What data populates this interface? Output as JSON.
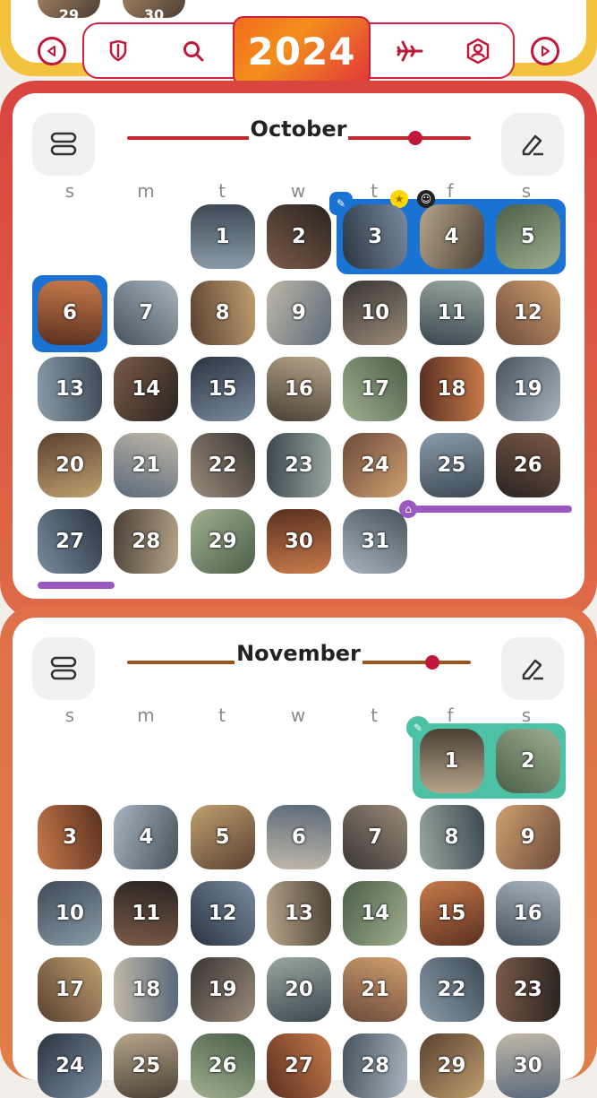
{
  "header": {
    "year": "2024",
    "peek_days": [
      "29",
      "30"
    ],
    "toolbar_icons": [
      "shield-icon",
      "search-icon",
      "airplane-icon",
      "profile-icon"
    ]
  },
  "months": [
    {
      "name": "October",
      "weekdays": [
        "s",
        "m",
        "t",
        "w",
        "t",
        "f",
        "s"
      ],
      "days": [
        "1",
        "2",
        "3",
        "4",
        "5",
        "6",
        "7",
        "8",
        "9",
        "10",
        "11",
        "12",
        "13",
        "14",
        "15",
        "16",
        "17",
        "18",
        "19",
        "20",
        "21",
        "22",
        "23",
        "24",
        "25",
        "26",
        "27",
        "28",
        "29",
        "30",
        "31"
      ]
    },
    {
      "name": "November",
      "weekdays": [
        "s",
        "m",
        "t",
        "w",
        "t",
        "f",
        "s"
      ],
      "days": [
        "1",
        "2",
        "3",
        "4",
        "5",
        "6",
        "7",
        "8",
        "9",
        "10",
        "11",
        "12",
        "13",
        "14",
        "15",
        "16",
        "17",
        "18",
        "19",
        "20",
        "21",
        "22",
        "23",
        "24",
        "25",
        "26",
        "27",
        "28",
        "29",
        "30"
      ]
    }
  ],
  "colors": {
    "accent_red": "#c0183a",
    "highlight_blue": "#1a73d2",
    "highlight_teal": "#4cc1a6",
    "event_bar_purple": "#9a59c0",
    "year_gradient": [
      "#f46b1d",
      "#e2363a"
    ]
  }
}
